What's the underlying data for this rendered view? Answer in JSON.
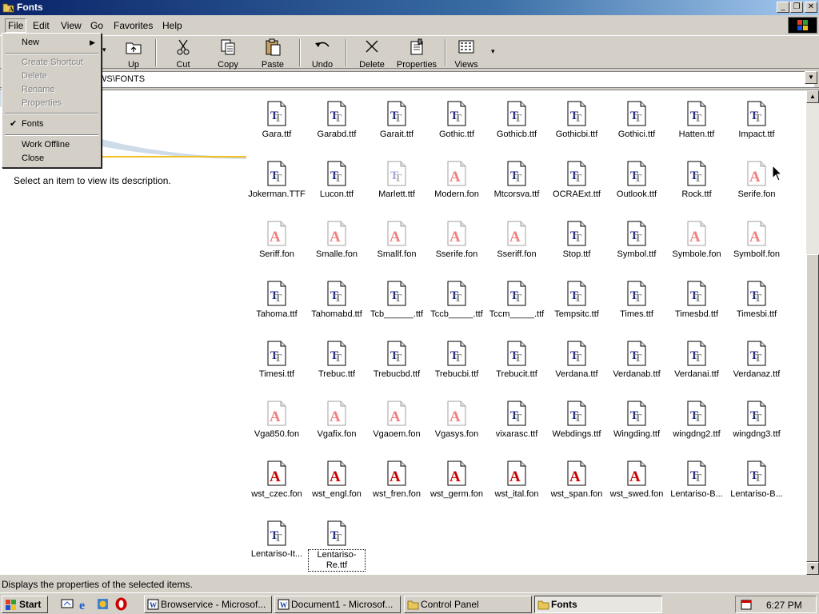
{
  "window": {
    "title": "Fonts"
  },
  "caption_buttons": {
    "minimize": "_",
    "maximize": "❐",
    "close": "✕"
  },
  "menubar": {
    "items": [
      {
        "label": "File",
        "underline": "F",
        "active": true
      },
      {
        "label": "Edit",
        "underline": "E"
      },
      {
        "label": "View",
        "underline": "V"
      },
      {
        "label": "Go",
        "underline": "G"
      },
      {
        "label": "Favorites",
        "underline": "a"
      },
      {
        "label": "Help",
        "underline": "H"
      }
    ]
  },
  "toolbar": {
    "up_label": "Up",
    "cut_label": "Cut",
    "copy_label": "Copy",
    "paste_label": "Paste",
    "undo_label": "Undo",
    "delete_label": "Delete",
    "properties_label": "Properties",
    "views_label": "Views"
  },
  "address": {
    "value": "WS\\FONTS"
  },
  "file_menu": {
    "items": [
      {
        "label": "New",
        "enabled": true,
        "submenu": true
      },
      {
        "label": "Create Shortcut",
        "enabled": false
      },
      {
        "label": "Delete",
        "enabled": false
      },
      {
        "label": "Rename",
        "enabled": false
      },
      {
        "label": "Properties",
        "enabled": false
      },
      {
        "label": "Fonts",
        "enabled": true,
        "checked": true
      },
      {
        "label": "Work Offline",
        "enabled": true
      },
      {
        "label": "Close",
        "enabled": true
      }
    ]
  },
  "left_pane": {
    "description": "Select an item to view its description."
  },
  "files": [
    {
      "name": "Gara.ttf",
      "type": "tt"
    },
    {
      "name": "Garabd.ttf",
      "type": "tt"
    },
    {
      "name": "Garait.ttf",
      "type": "tt"
    },
    {
      "name": "Gothic.ttf",
      "type": "tt"
    },
    {
      "name": "Gothicb.ttf",
      "type": "tt"
    },
    {
      "name": "Gothicbi.ttf",
      "type": "tt"
    },
    {
      "name": "Gothici.ttf",
      "type": "tt"
    },
    {
      "name": "Hatten.ttf",
      "type": "tt"
    },
    {
      "name": "Impact.ttf",
      "type": "tt"
    },
    {
      "name": "Jokerman.TTF",
      "type": "tt"
    },
    {
      "name": "Lucon.ttf",
      "type": "tt"
    },
    {
      "name": "Marlett.ttf",
      "type": "tt-hidden"
    },
    {
      "name": "Modern.fon",
      "type": "fon-hidden"
    },
    {
      "name": "Mtcorsva.ttf",
      "type": "tt"
    },
    {
      "name": "OCRAExt.ttf",
      "type": "tt"
    },
    {
      "name": "Outlook.ttf",
      "type": "tt"
    },
    {
      "name": "Rock.ttf",
      "type": "tt"
    },
    {
      "name": "Serife.fon",
      "type": "fon-hidden"
    },
    {
      "name": "Seriff.fon",
      "type": "fon-hidden"
    },
    {
      "name": "Smalle.fon",
      "type": "fon-hidden"
    },
    {
      "name": "Smallf.fon",
      "type": "fon-hidden"
    },
    {
      "name": "Sserife.fon",
      "type": "fon-hidden"
    },
    {
      "name": "Sseriff.fon",
      "type": "fon-hidden"
    },
    {
      "name": "Stop.ttf",
      "type": "tt"
    },
    {
      "name": "Symbol.ttf",
      "type": "tt"
    },
    {
      "name": "Symbole.fon",
      "type": "fon-hidden"
    },
    {
      "name": "Symbolf.fon",
      "type": "fon-hidden"
    },
    {
      "name": "Tahoma.ttf",
      "type": "tt"
    },
    {
      "name": "Tahomabd.ttf",
      "type": "tt"
    },
    {
      "name": "Tcb______.ttf",
      "type": "tt"
    },
    {
      "name": "Tccb_____.ttf",
      "type": "tt"
    },
    {
      "name": "Tccm_____.ttf",
      "type": "tt"
    },
    {
      "name": "Tempsitc.ttf",
      "type": "tt"
    },
    {
      "name": "Times.ttf",
      "type": "tt"
    },
    {
      "name": "Timesbd.ttf",
      "type": "tt"
    },
    {
      "name": "Timesbi.ttf",
      "type": "tt"
    },
    {
      "name": "Timesi.ttf",
      "type": "tt"
    },
    {
      "name": "Trebuc.ttf",
      "type": "tt"
    },
    {
      "name": "Trebucbd.ttf",
      "type": "tt"
    },
    {
      "name": "Trebucbi.ttf",
      "type": "tt"
    },
    {
      "name": "Trebucit.ttf",
      "type": "tt"
    },
    {
      "name": "Verdana.ttf",
      "type": "tt"
    },
    {
      "name": "Verdanab.ttf",
      "type": "tt"
    },
    {
      "name": "Verdanai.ttf",
      "type": "tt"
    },
    {
      "name": "Verdanaz.ttf",
      "type": "tt"
    },
    {
      "name": "Vga850.fon",
      "type": "fon-hidden"
    },
    {
      "name": "Vgafix.fon",
      "type": "fon-hidden"
    },
    {
      "name": "Vgaoem.fon",
      "type": "fon-hidden"
    },
    {
      "name": "Vgasys.fon",
      "type": "fon-hidden"
    },
    {
      "name": "vixarasc.ttf",
      "type": "tt"
    },
    {
      "name": "Webdings.ttf",
      "type": "tt"
    },
    {
      "name": "Wingding.ttf",
      "type": "tt"
    },
    {
      "name": "wingdng2.ttf",
      "type": "tt"
    },
    {
      "name": "wingdng3.ttf",
      "type": "tt"
    },
    {
      "name": "wst_czec.fon",
      "type": "fon"
    },
    {
      "name": "wst_engl.fon",
      "type": "fon"
    },
    {
      "name": "wst_fren.fon",
      "type": "fon"
    },
    {
      "name": "wst_germ.fon",
      "type": "fon"
    },
    {
      "name": "wst_ital.fon",
      "type": "fon"
    },
    {
      "name": "wst_span.fon",
      "type": "fon"
    },
    {
      "name": "wst_swed.fon",
      "type": "fon"
    },
    {
      "name": "Lentariso-B...",
      "type": "tt"
    },
    {
      "name": "Lentariso-B...",
      "type": "tt"
    },
    {
      "name": "Lentariso-It...",
      "type": "tt"
    },
    {
      "name": "Lentariso-Re.ttf",
      "type": "tt",
      "selected": true
    }
  ],
  "statusbar": {
    "text": "Displays the properties of the selected items."
  },
  "taskbar": {
    "start_label": "Start",
    "tasks": [
      {
        "label": "Browservice - Microsof..."
      },
      {
        "label": "Document1 - Microsof..."
      },
      {
        "label": "Control Panel"
      },
      {
        "label": "Fonts",
        "pressed": true
      }
    ],
    "clock": "6:27 PM"
  },
  "colors": {
    "titlebar": "#0a246a",
    "tt_icon": "#1a237e",
    "fon_icon": "#cc0000",
    "fon_hidden": "#f08080"
  }
}
